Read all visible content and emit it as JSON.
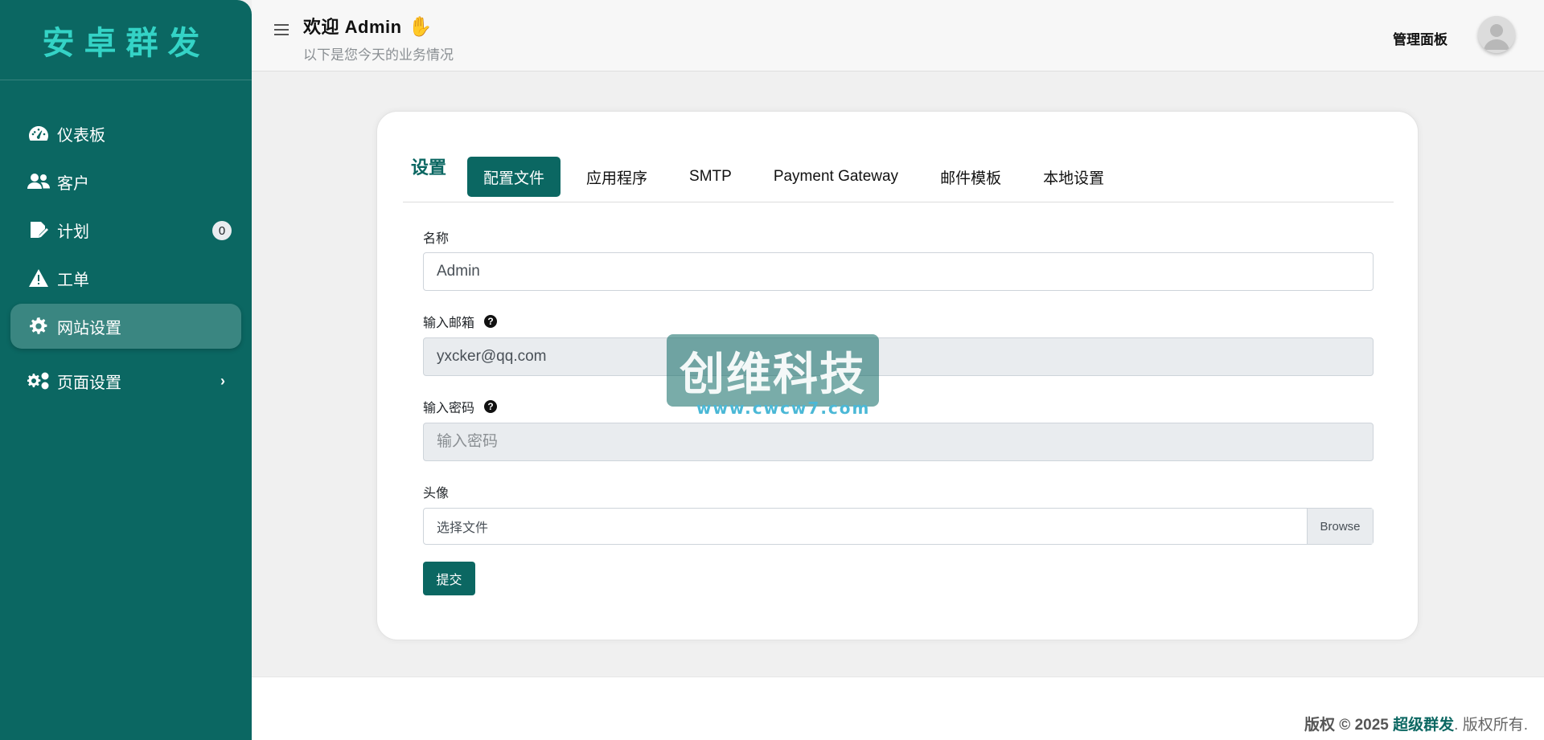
{
  "sidebar": {
    "brand": "安卓群发",
    "items": [
      {
        "label": "仪表板",
        "icon": "dashboard-icon"
      },
      {
        "label": "客户",
        "icon": "users-icon"
      },
      {
        "label": "计划",
        "icon": "schedule-icon",
        "badge": "0"
      },
      {
        "label": "工单",
        "icon": "warning-icon"
      },
      {
        "label": "网站设置",
        "icon": "gear-icon",
        "active": true
      },
      {
        "label": "页面设置",
        "icon": "gears-icon",
        "chevron": "›"
      }
    ]
  },
  "header": {
    "welcome": "欢迎 Admin",
    "wave_icon": "waving-hand-icon",
    "subtitle": "以下是您今天的业务情况",
    "admin_panel": "管理面板"
  },
  "settings": {
    "title": "设置",
    "tabs": [
      {
        "label": "配置文件",
        "active": true
      },
      {
        "label": "应用程序"
      },
      {
        "label": "SMTP"
      },
      {
        "label": "Payment Gateway"
      },
      {
        "label": "邮件模板"
      },
      {
        "label": "本地设置"
      }
    ],
    "form": {
      "name_label": "名称",
      "name_value": "Admin",
      "email_label": "输入邮箱",
      "email_value": "yxcker@qq.com",
      "password_label": "输入密码",
      "password_placeholder": "输入密码",
      "avatar_label": "头像",
      "file_label": "选择文件",
      "browse_label": "Browse",
      "submit_label": "提交"
    }
  },
  "watermark": {
    "title": "创维科技",
    "url": "www.cwcw7.com"
  },
  "footer": {
    "prefix": "版权 © 2025",
    "brand": "超级群发",
    "suffix": ". 版权所有."
  },
  "colors": {
    "primary": "#0b6762",
    "brand_text": "#34d3c6",
    "active_nav": "#3a8681"
  }
}
